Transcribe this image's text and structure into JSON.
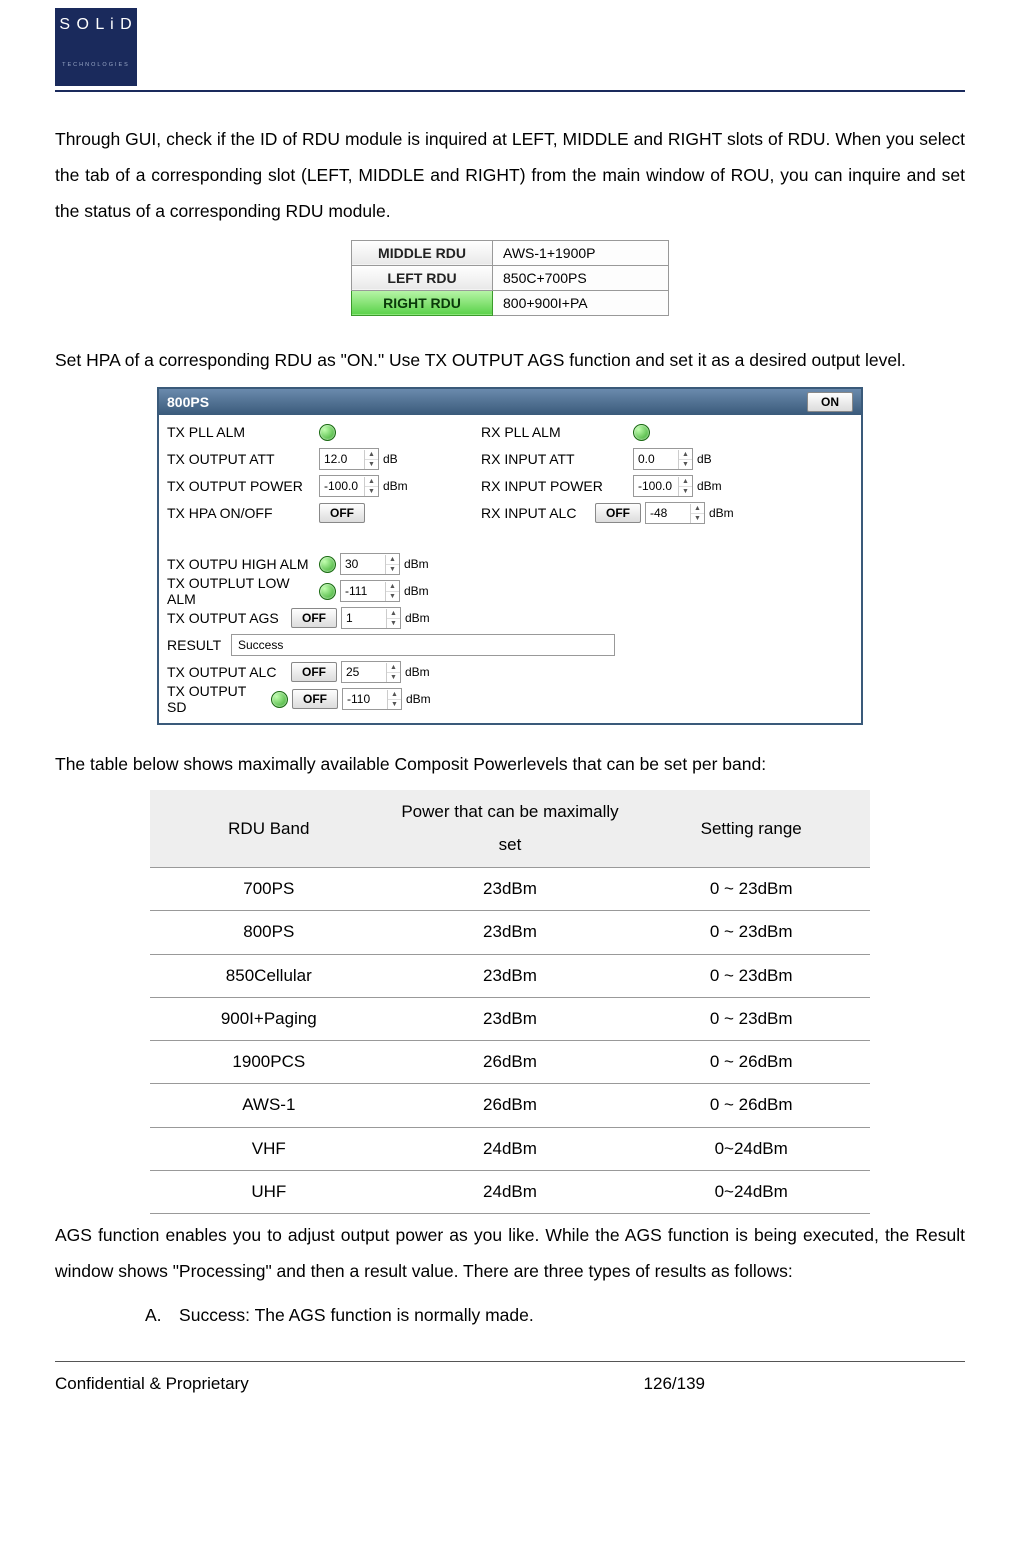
{
  "logo": {
    "top": "S O L i D",
    "bottom": "TECHNOLOGIES"
  },
  "para1": "Through GUI, check if the ID of RDU module is inquired at LEFT, MIDDLE and RIGHT slots of RDU. When you select the tab of a corresponding slot (LEFT, MIDDLE and RIGHT) from the main window of ROU, you can inquire and set the status of a corresponding RDU module.",
  "rdu_slots": [
    {
      "label": "MIDDLE RDU",
      "value": "AWS-1+1900P",
      "active": false
    },
    {
      "label": "LEFT RDU",
      "value": "850C+700PS",
      "active": false
    },
    {
      "label": "RIGHT RDU",
      "value": "800+900I+PA",
      "active": true
    }
  ],
  "para2": "Set HPA of a corresponding RDU as \"ON.\" Use TX OUTPUT AGS function and set it as a desired output level.",
  "panel": {
    "title": "800PS",
    "on": "ON",
    "off": "OFF",
    "success": "Success",
    "labels": {
      "tx_pll": "TX PLL ALM",
      "rx_pll": "RX PLL ALM",
      "tx_att": "TX OUTPUT ATT",
      "rx_att": "RX INPUT ATT",
      "tx_pwr": "TX OUTPUT POWER",
      "rx_pwr": "RX INPUT POWER",
      "tx_hpa": "TX HPA ON/OFF",
      "rx_alc": "RX INPUT ALC",
      "tx_hi": "TX OUTPU HIGH ALM",
      "tx_lo": "TX OUTPLUT LOW ALM",
      "tx_ags": "TX OUTPUT AGS",
      "result": "RESULT",
      "tx_alc": "TX OUTPUT ALC",
      "tx_sd": "TX OUTPUT SD"
    },
    "vals": {
      "tx_att": "12.0",
      "rx_att": "0.0",
      "tx_pwr": "-100.0",
      "rx_pwr": "-100.0",
      "rx_alc": "-48",
      "tx_hi": "30",
      "tx_lo": "-111",
      "tx_ags": "1",
      "tx_alc": "25",
      "tx_sd": "-110"
    },
    "units": {
      "db": "dB",
      "dbm": "dBm"
    }
  },
  "para3": "The table below shows maximally available Composit Powerlevels that can be set per band:",
  "band_hdr": {
    "c1": "RDU Band",
    "c2": "Power that can be maximally set",
    "c3": "Setting range"
  },
  "bands": [
    {
      "b": "700PS",
      "p": "23dBm",
      "r": "0 ~ 23dBm"
    },
    {
      "b": "800PS",
      "p": "23dBm",
      "r": "0 ~ 23dBm"
    },
    {
      "b": "850Cellular",
      "p": "23dBm",
      "r": "0 ~ 23dBm"
    },
    {
      "b": "900I+Paging",
      "p": "23dBm",
      "r": "0 ~ 23dBm"
    },
    {
      "b": "1900PCS",
      "p": "26dBm",
      "r": "0 ~ 26dBm"
    },
    {
      "b": "AWS-1",
      "p": "26dBm",
      "r": "0 ~ 26dBm"
    },
    {
      "b": "VHF",
      "p": "24dBm",
      "r": "0~24dBm"
    },
    {
      "b": "UHF",
      "p": "24dBm",
      "r": "0~24dBm"
    }
  ],
  "para4": "AGS function enables you to adjust output power as you like. While the AGS function is being executed, the Result window shows \"Processing\" and then a result value. There are three types of results as follows:",
  "list_a": "A. Success: The AGS function is normally made.",
  "footer": {
    "left": "Confidential & Proprietary",
    "center": "126/139"
  }
}
